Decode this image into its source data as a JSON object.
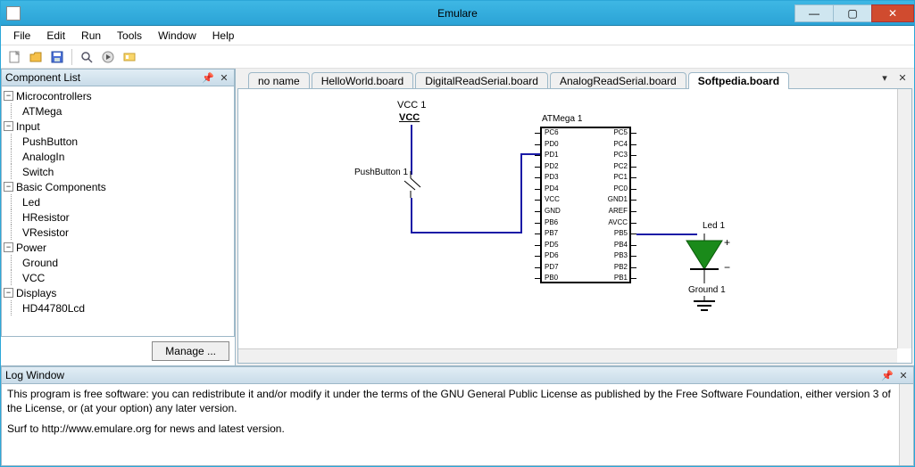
{
  "window": {
    "title": "Emulare"
  },
  "menu": {
    "file": "File",
    "edit": "Edit",
    "run": "Run",
    "tools": "Tools",
    "window": "Window",
    "help": "Help"
  },
  "sidebar": {
    "title": "Component List",
    "manage_label": "Manage ...",
    "groups": [
      {
        "label": "Microcontrollers",
        "items": [
          "ATMega"
        ]
      },
      {
        "label": "Input",
        "items": [
          "PushButton",
          "AnalogIn",
          "Switch"
        ]
      },
      {
        "label": "Basic Components",
        "items": [
          "Led",
          "HResistor",
          "VResistor"
        ]
      },
      {
        "label": "Power",
        "items": [
          "Ground",
          "VCC"
        ]
      },
      {
        "label": "Displays",
        "items": [
          "HD44780Lcd"
        ]
      }
    ]
  },
  "tabs": {
    "items": [
      "no name",
      "HelloWorld.board",
      "DigitalReadSerial.board",
      "AnalogReadSerial.board",
      "Softpedia.board"
    ],
    "active": 4
  },
  "diagram": {
    "vcc_label": "VCC 1",
    "vcc_text": "VCC",
    "pushbutton_label": "PushButton 1",
    "atmega_label": "ATMega 1",
    "led_label": "Led 1",
    "ground_label": "Ground 1",
    "pins_left": [
      "PC6",
      "PD0",
      "PD1",
      "PD2",
      "PD3",
      "PD4",
      "VCC",
      "GND",
      "PB6",
      "PB7",
      "PD5",
      "PD6",
      "PD7",
      "PB0"
    ],
    "pins_right": [
      "PC5",
      "PC4",
      "PC3",
      "PC2",
      "PC1",
      "PC0",
      "GND1",
      "AREF",
      "AVCC",
      "PB5",
      "PB4",
      "PB3",
      "PB2",
      "PB1"
    ]
  },
  "log": {
    "title": "Log Window",
    "line1": "This program is free software: you can redistribute it and/or modify it under the terms of the GNU General Public License as published by the Free Software Foundation, either version 3 of the License, or (at your option) any later version.",
    "line2": "Surf to http://www.emulare.org for news and latest version."
  }
}
